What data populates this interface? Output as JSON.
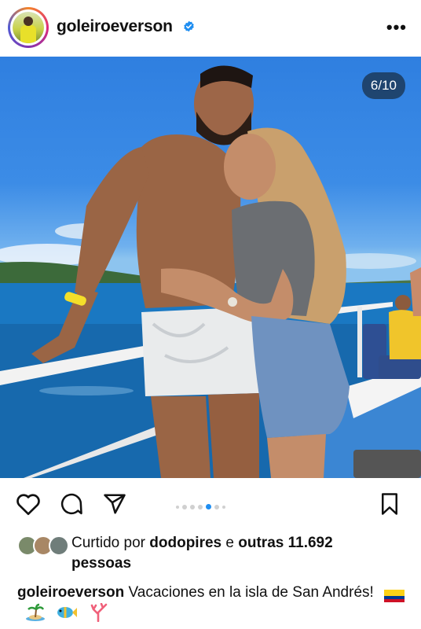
{
  "post": {
    "username": "goleiroeverson",
    "verified": true,
    "more_label": "•••",
    "carousel": {
      "position_label": "6/10",
      "current": 6,
      "total": 10
    },
    "likes": {
      "prefix": "Curtido por",
      "user": "dodopires",
      "middle": "e",
      "others": "outras 11.692",
      "suffix": "pessoas"
    },
    "caption": {
      "username": "goleiroeverson",
      "text": "Vacaciones en la isla de San Andrés!",
      "emojis": [
        "colombia-flag",
        "island",
        "fish",
        "coral"
      ]
    }
  },
  "icons": {
    "like": "heart-icon",
    "comment": "comment-icon",
    "share": "send-icon",
    "save": "bookmark-icon"
  },
  "colors": {
    "verified_blue": "#1f8ef1",
    "active_dot": "#1f8ef1",
    "text": "#111111"
  }
}
